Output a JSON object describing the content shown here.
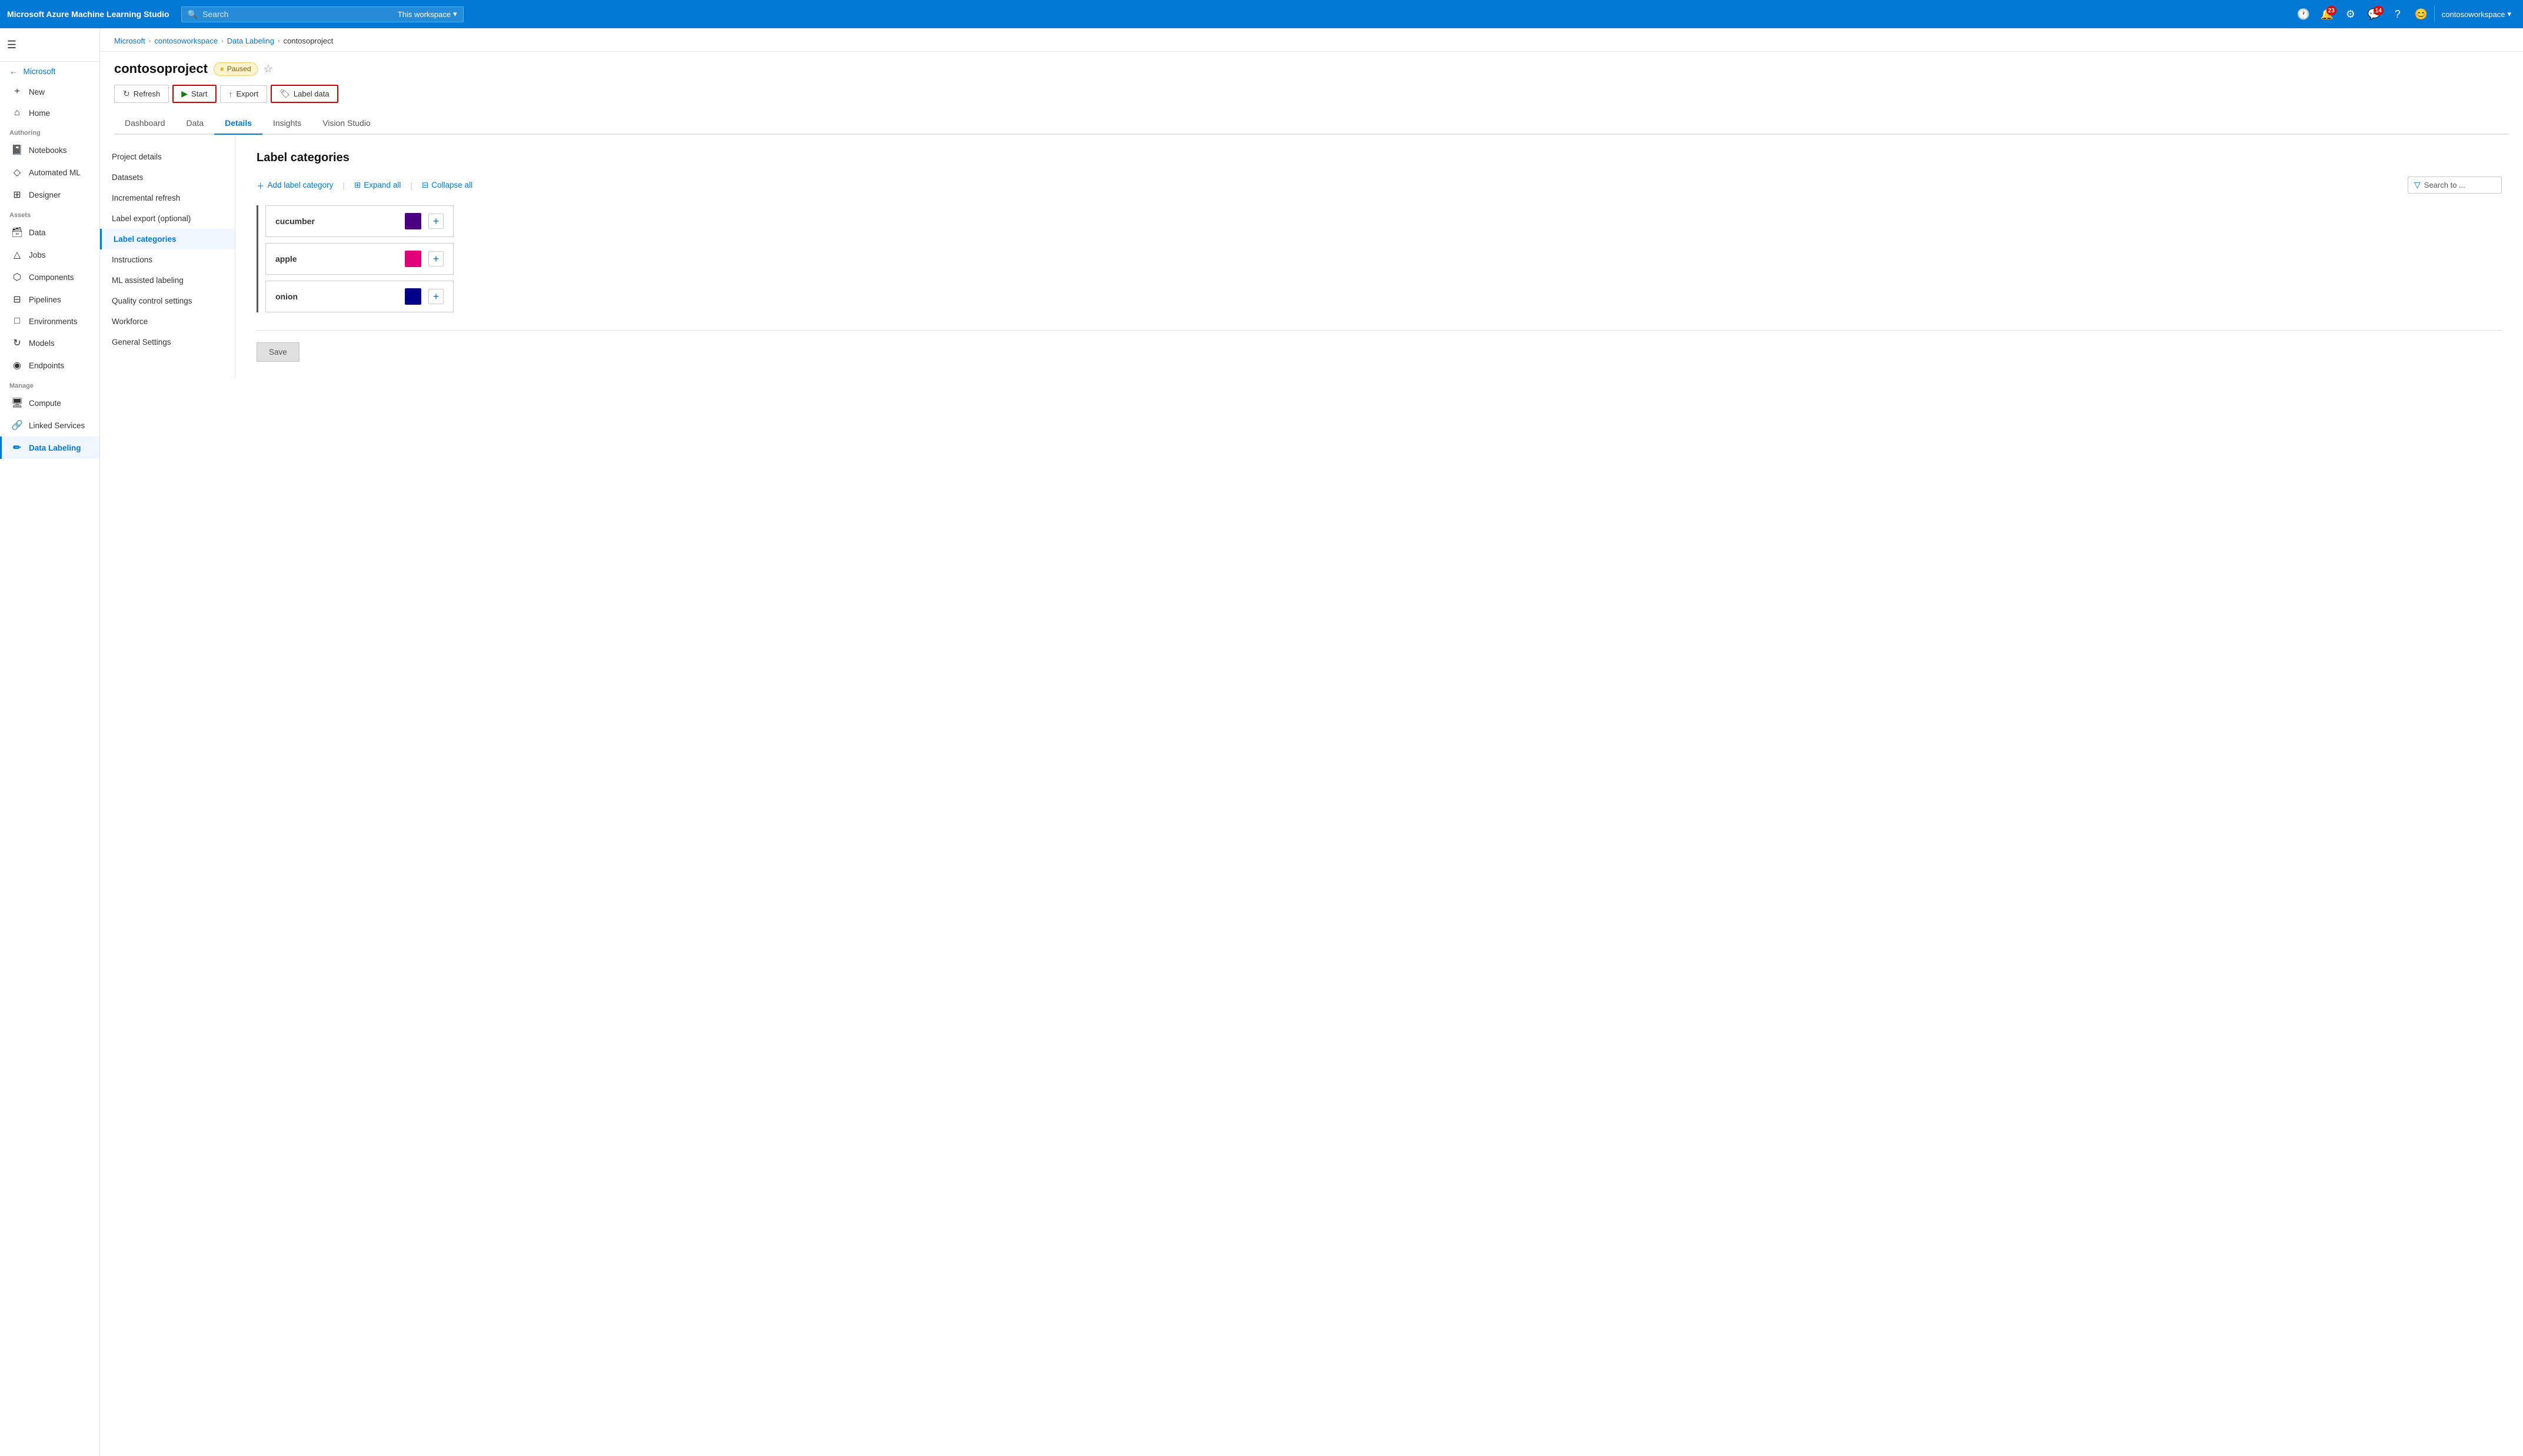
{
  "topNav": {
    "appName": "Microsoft Azure Machine Learning Studio",
    "searchPlaceholder": "Search",
    "workspaceLabel": "This workspace",
    "notificationCount1": "23",
    "notificationCount2": "14",
    "username": "contosoworkspace",
    "chevron": "▾"
  },
  "breadcrumb": {
    "items": [
      "Microsoft",
      "contosoworkspace",
      "Data Labeling",
      "contosoproject"
    ],
    "separators": [
      ">",
      ">",
      ">"
    ]
  },
  "pageHeader": {
    "title": "contosoproject",
    "status": "Paused",
    "buttons": {
      "refresh": "Refresh",
      "start": "Start",
      "export": "Export",
      "labelData": "Label data"
    }
  },
  "tabs": [
    "Dashboard",
    "Data",
    "Details",
    "Insights",
    "Vision Studio"
  ],
  "activeTab": "Details",
  "leftNav": {
    "items": [
      "Project details",
      "Datasets",
      "Incremental refresh",
      "Label export (optional)",
      "Label categories",
      "Instructions",
      "ML assisted labeling",
      "Quality control settings",
      "Workforce",
      "General Settings"
    ],
    "activeItem": "Label categories"
  },
  "labelCategories": {
    "title": "Label categories",
    "toolbar": {
      "addLabel": "Add label category",
      "expandAll": "Expand all",
      "collapseAll": "Collapse all",
      "searchPlaceholder": "Search to ..."
    },
    "categories": [
      {
        "name": "cucumber",
        "color": "#4b0082"
      },
      {
        "name": "apple",
        "color": "#e0007a"
      },
      {
        "name": "onion",
        "color": "#00008b"
      }
    ]
  },
  "sidebar": {
    "hamburgerTitle": "☰",
    "microsoftLabel": "Microsoft",
    "sections": {
      "authoring": "Authoring",
      "assets": "Assets",
      "manage": "Manage"
    },
    "items": [
      {
        "label": "New",
        "icon": "+",
        "section": "top"
      },
      {
        "label": "Home",
        "icon": "⌂",
        "section": "top"
      },
      {
        "label": "Notebooks",
        "icon": "📓",
        "section": "authoring"
      },
      {
        "label": "Automated ML",
        "icon": "◇",
        "section": "authoring"
      },
      {
        "label": "Designer",
        "icon": "⊞",
        "section": "authoring"
      },
      {
        "label": "Data",
        "icon": "🗃",
        "section": "assets"
      },
      {
        "label": "Jobs",
        "icon": "△",
        "section": "assets"
      },
      {
        "label": "Components",
        "icon": "⬡",
        "section": "assets"
      },
      {
        "label": "Pipelines",
        "icon": "⊟",
        "section": "assets"
      },
      {
        "label": "Environments",
        "icon": "□",
        "section": "assets"
      },
      {
        "label": "Models",
        "icon": "↻",
        "section": "assets"
      },
      {
        "label": "Endpoints",
        "icon": "◉",
        "section": "assets"
      },
      {
        "label": "Compute",
        "icon": "🖥",
        "section": "manage"
      },
      {
        "label": "Linked Services",
        "icon": "🔗",
        "section": "manage"
      },
      {
        "label": "Data Labeling",
        "icon": "✏",
        "section": "manage",
        "active": true
      }
    ]
  },
  "save": {
    "label": "Save"
  }
}
